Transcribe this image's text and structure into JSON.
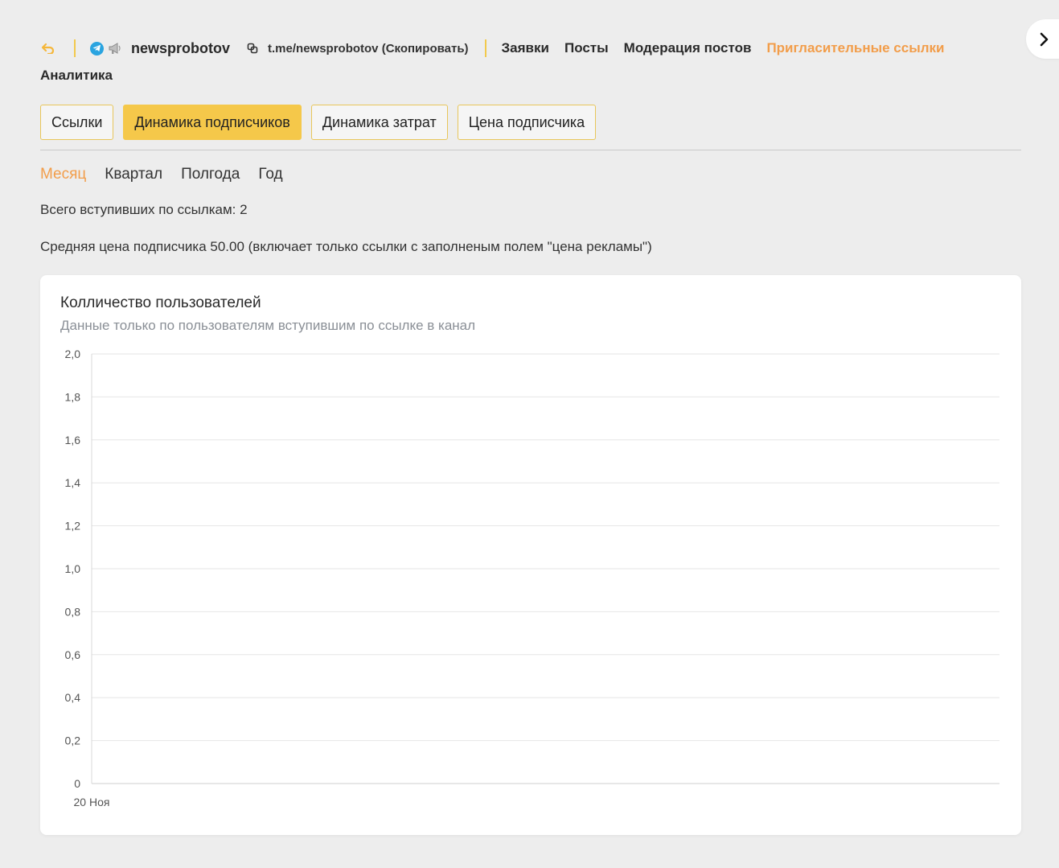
{
  "header": {
    "channel_name": "newsprobotov",
    "channel_link": "t.me/newsprobotov (Скопировать)",
    "nav": [
      {
        "label": "Заявки",
        "active": false
      },
      {
        "label": "Посты",
        "active": false
      },
      {
        "label": "Модерация постов",
        "active": false
      },
      {
        "label": "Пригласительные ссылки",
        "active": true
      }
    ],
    "nav_row2": {
      "label": "Аналитика",
      "active": false
    },
    "icons": {
      "back": "back-arrow-icon",
      "telegram": "telegram-icon",
      "channel": "megaphone-icon",
      "copy": "copy-link-icon",
      "side": "chevron-right-icon"
    }
  },
  "tabs": [
    {
      "label": "Ссылки",
      "active": false
    },
    {
      "label": "Динамика подписчиков",
      "active": true
    },
    {
      "label": "Динамика затрат",
      "active": false
    },
    {
      "label": "Цена подписчика",
      "active": false
    }
  ],
  "periods": [
    {
      "label": "Месяц",
      "active": true
    },
    {
      "label": "Квартал",
      "active": false
    },
    {
      "label": "Полгода",
      "active": false
    },
    {
      "label": "Год",
      "active": false
    }
  ],
  "stats": {
    "total_joined": "Всего вступивших по ссылкам: 2",
    "avg_price": "Средняя цена подписчика 50.00 (включает только ссылки с заполненым полем \"цена рекламы\")"
  },
  "colors": {
    "accent": "#f29d4a",
    "active_tab": "#f5c84a",
    "divider": "#f2c94c",
    "background": "#ededed"
  },
  "chart_data": {
    "type": "line",
    "title": "Колличество пользователей",
    "subtitle": "Данные только по пользователям вступившим по ссылке в канал",
    "x": [
      "20 Ноя"
    ],
    "series": [],
    "ylim": [
      0,
      2
    ],
    "yticks": [
      "0",
      "0,2",
      "0,4",
      "0,6",
      "0,8",
      "1,0",
      "1,2",
      "1,4",
      "1,6",
      "1,8",
      "2,0"
    ],
    "grid": true
  }
}
